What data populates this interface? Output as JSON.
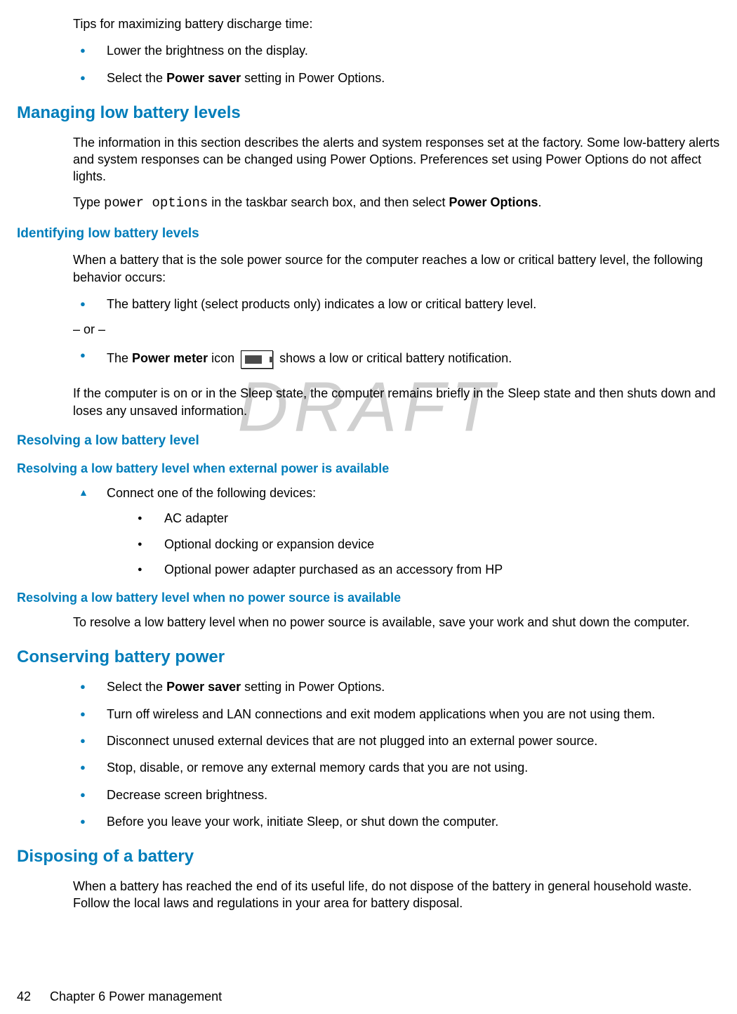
{
  "watermark": "DRAFT",
  "intro": {
    "tips_heading": "Tips for maximizing battery discharge time:",
    "tips_list": {
      "0": "Lower the brightness on the display.",
      "1_pre": "Select the ",
      "1_bold": "Power saver",
      "1_post": " setting in Power Options."
    }
  },
  "managing": {
    "heading": "Managing low battery levels",
    "para1": "The information in this section describes the alerts and system responses set at the factory. Some low-battery alerts and system responses can be changed using Power Options. Preferences set using Power Options do not affect lights.",
    "para2_pre": "Type ",
    "para2_code": "power options",
    "para2_mid": " in the taskbar search box, and then select ",
    "para2_bold": "Power Options",
    "para2_post": "."
  },
  "identifying": {
    "heading": "Identifying low battery levels",
    "para1": "When a battery that is the sole power source for the computer reaches a low or critical battery level, the following behavior occurs:",
    "bullet1": "The battery light (select products only) indicates a low or critical battery level.",
    "or": "– or –",
    "bullet2_pre": "The ",
    "bullet2_bold": "Power meter",
    "bullet2_mid": " icon ",
    "bullet2_post": " shows a low or critical battery notification.",
    "para2": "If the computer is on or in the Sleep state, the computer remains briefly in the Sleep state and then shuts down and loses any unsaved information."
  },
  "resolving": {
    "heading": "Resolving a low battery level",
    "ext_heading": "Resolving a low battery level when external power is available",
    "connect_intro": "Connect one of the following devices:",
    "devices": {
      "0": "AC adapter",
      "1": "Optional docking or expansion device",
      "2": "Optional power adapter purchased as an accessory from HP"
    },
    "nopower_heading": "Resolving a low battery level when no power source is available",
    "nopower_para": "To resolve a low battery level when no power source is available, save your work and shut down the computer."
  },
  "conserving": {
    "heading": "Conserving battery power",
    "bullets": {
      "0_pre": "Select the ",
      "0_bold": "Power saver",
      "0_post": " setting in Power Options.",
      "1": "Turn off wireless and LAN connections and exit modem applications when you are not using them.",
      "2": "Disconnect unused external devices that are not plugged into an external power source.",
      "3": "Stop, disable, or remove any external memory cards that you are not using.",
      "4": "Decrease screen brightness.",
      "5": "Before you leave your work, initiate Sleep, or shut down the computer."
    }
  },
  "disposing": {
    "heading": "Disposing of a battery",
    "para": "When a battery has reached the end of its useful life, do not dispose of the battery in general household waste. Follow the local laws and regulations in your area for battery disposal."
  },
  "footer": {
    "page": "42",
    "chapter": "Chapter 6   Power management"
  }
}
